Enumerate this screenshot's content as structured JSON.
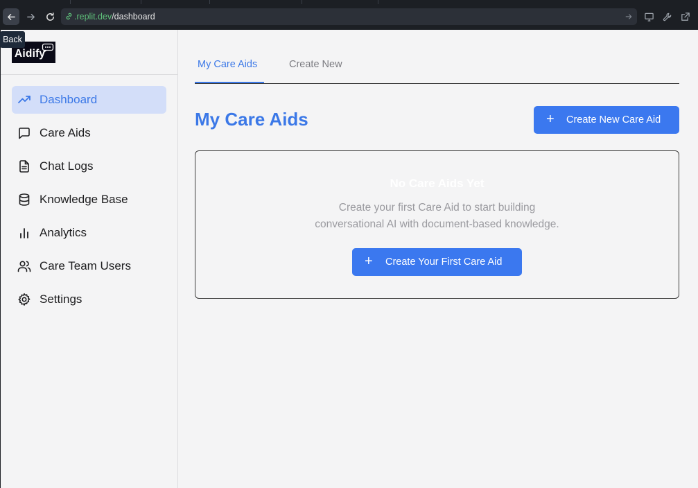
{
  "browser": {
    "url_host": ".replit.dev",
    "url_path": "/dashboard",
    "tooltip": "Back"
  },
  "app": {
    "logo_text": "Aidify"
  },
  "sidebar": {
    "items": [
      {
        "label": "Dashboard",
        "icon": "trending-up-icon",
        "active": true
      },
      {
        "label": "Care Aids",
        "icon": "message-square-icon",
        "active": false
      },
      {
        "label": "Chat Logs",
        "icon": "file-text-icon",
        "active": false
      },
      {
        "label": "Knowledge Base",
        "icon": "database-icon",
        "active": false
      },
      {
        "label": "Analytics",
        "icon": "bar-chart-icon",
        "active": false
      },
      {
        "label": "Care Team Users",
        "icon": "users-icon",
        "active": false
      },
      {
        "label": "Settings",
        "icon": "gear-icon",
        "active": false
      }
    ]
  },
  "tabs": [
    {
      "label": "My Care Aids",
      "active": true
    },
    {
      "label": "Create New",
      "active": false
    }
  ],
  "main": {
    "title": "My Care Aids",
    "create_button": {
      "icon": "plus",
      "label": "Create New Care Aid"
    },
    "empty_state": {
      "title": "No Care Aids Yet",
      "description_line1": "Create your first Care Aid to start building",
      "description_line2": "conversational AI with document-based knowledge.",
      "button": {
        "icon": "plus",
        "label": "Create Your First Care Aid"
      }
    }
  },
  "colors": {
    "accent": "#3b78e7",
    "active_nav_bg": "#d3def9",
    "button_bg": "#3b78ef",
    "page_bg": "#f4f4f5"
  }
}
